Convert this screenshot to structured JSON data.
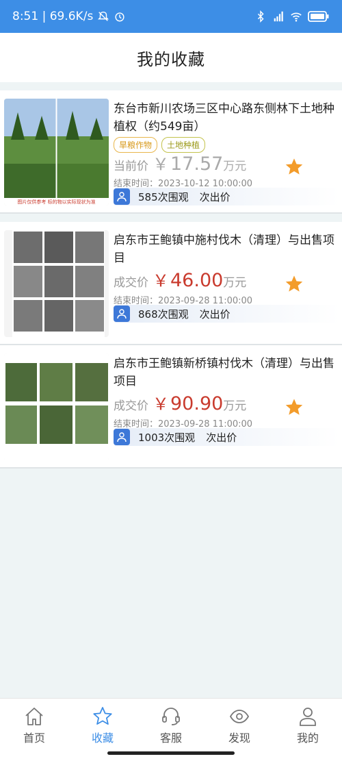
{
  "status_bar": {
    "time_speed": "8:51 | 69.6K/s"
  },
  "header": {
    "title": "我的收藏"
  },
  "items": [
    {
      "name": "东台市新川农场三区中心路东侧林下土地种植权（约549亩）",
      "tags": [
        "旱粮作物",
        "土地种植"
      ],
      "price_label": "当前价",
      "currency": "￥",
      "price": "17.57",
      "unit": "万元",
      "end_time": "结束时间：2023-10-12 10:00:00",
      "views": "585次围观",
      "bids": "次出价",
      "thumb_caption": "图片仅供参考  标的物以实际现状为准"
    },
    {
      "name": " 启东市王鲍镇中施村伐木（清理）与出售项目",
      "tags": [],
      "price_label": "成交价",
      "currency": "￥",
      "price": "46.00",
      "unit": "万元",
      "end_time": "结束时间：2023-09-28 11:00:00",
      "views": "868次围观",
      "bids": "次出价"
    },
    {
      "name": "启东市王鲍镇新桥镇村伐木（清理）与出售项目",
      "tags": [],
      "price_label": "成交价",
      "currency": "￥",
      "price": "90.90",
      "unit": "万元",
      "end_time": "结束时间：2023-09-28 11:00:00",
      "views": "1003次围观",
      "bids": "次出价"
    }
  ],
  "tabbar": {
    "home": "首页",
    "favorites": "收藏",
    "service": "客服",
    "discover": "发现",
    "mine": "我的"
  },
  "colors": {
    "accent": "#3d8ee6",
    "price_red": "#c93b2e",
    "star": "#f39c2b"
  }
}
